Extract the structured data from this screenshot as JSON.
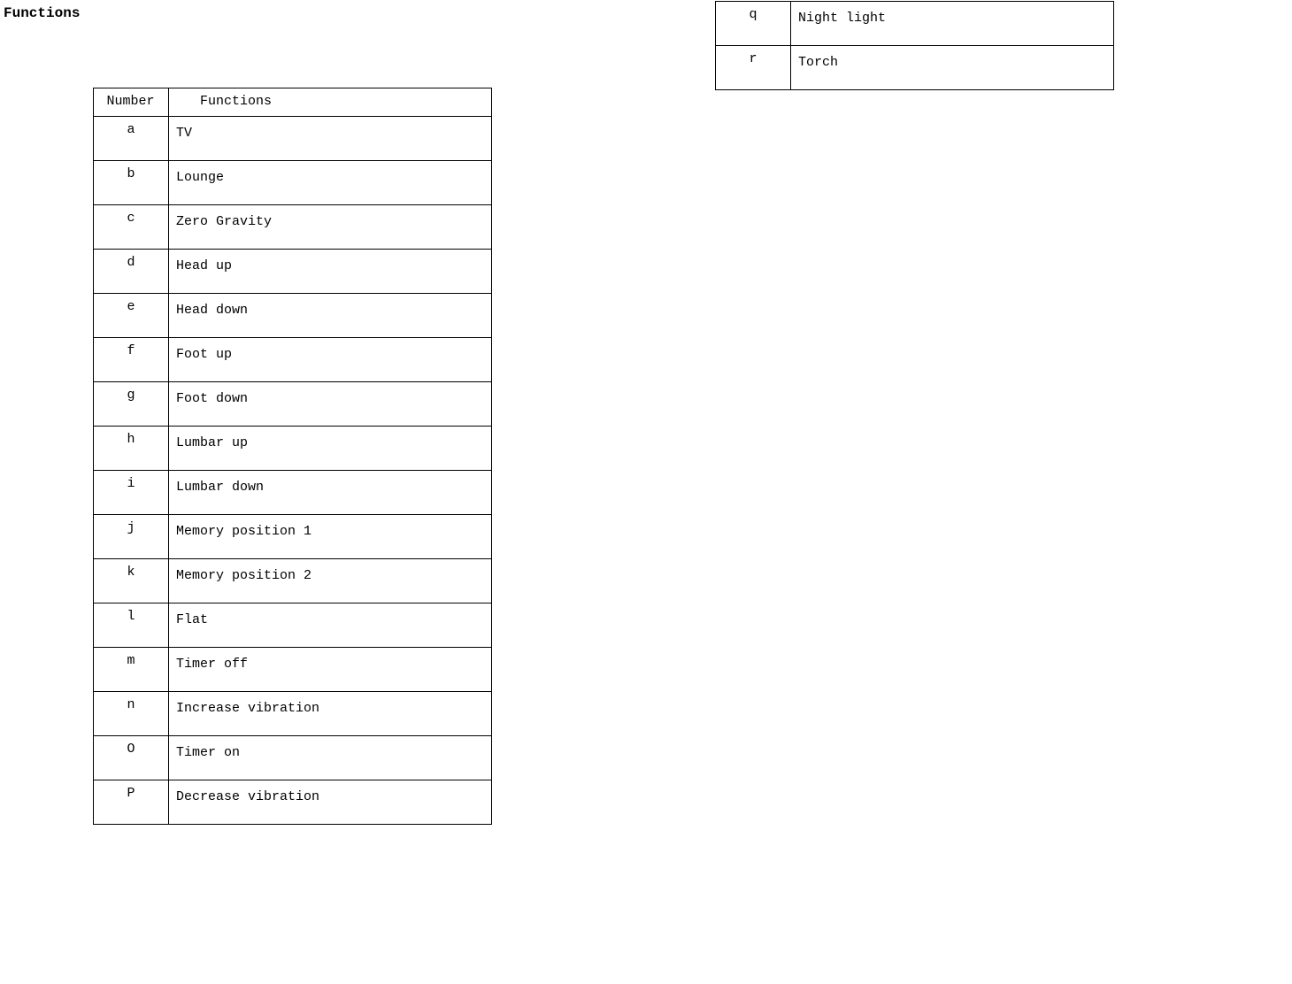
{
  "title": "Functions",
  "left_table": {
    "headers": {
      "number": "Number",
      "function": "Functions"
    },
    "rows": [
      {
        "num": "a",
        "func": "TV"
      },
      {
        "num": "b",
        "func": "Lounge"
      },
      {
        "num": "c",
        "func": "Zero Gravity"
      },
      {
        "num": "d",
        "func": "Head up"
      },
      {
        "num": "e",
        "func": "Head down"
      },
      {
        "num": "f",
        "func": "Foot up"
      },
      {
        "num": "g",
        "func": "Foot down"
      },
      {
        "num": "h",
        "func": "Lumbar up"
      },
      {
        "num": "i",
        "func": "Lumbar down"
      },
      {
        "num": "j",
        "func": "Memory position 1"
      },
      {
        "num": "k",
        "func": "Memory position 2"
      },
      {
        "num": "l",
        "func": "Flat"
      },
      {
        "num": "m",
        "func": "Timer off"
      },
      {
        "num": "n",
        "func": "Increase vibration"
      },
      {
        "num": "O",
        "func": "Timer on"
      },
      {
        "num": "P",
        "func": "Decrease vibration"
      }
    ]
  },
  "right_table": {
    "rows": [
      {
        "num": "q",
        "func": "Night light"
      },
      {
        "num": "r",
        "func": "Torch"
      }
    ]
  }
}
